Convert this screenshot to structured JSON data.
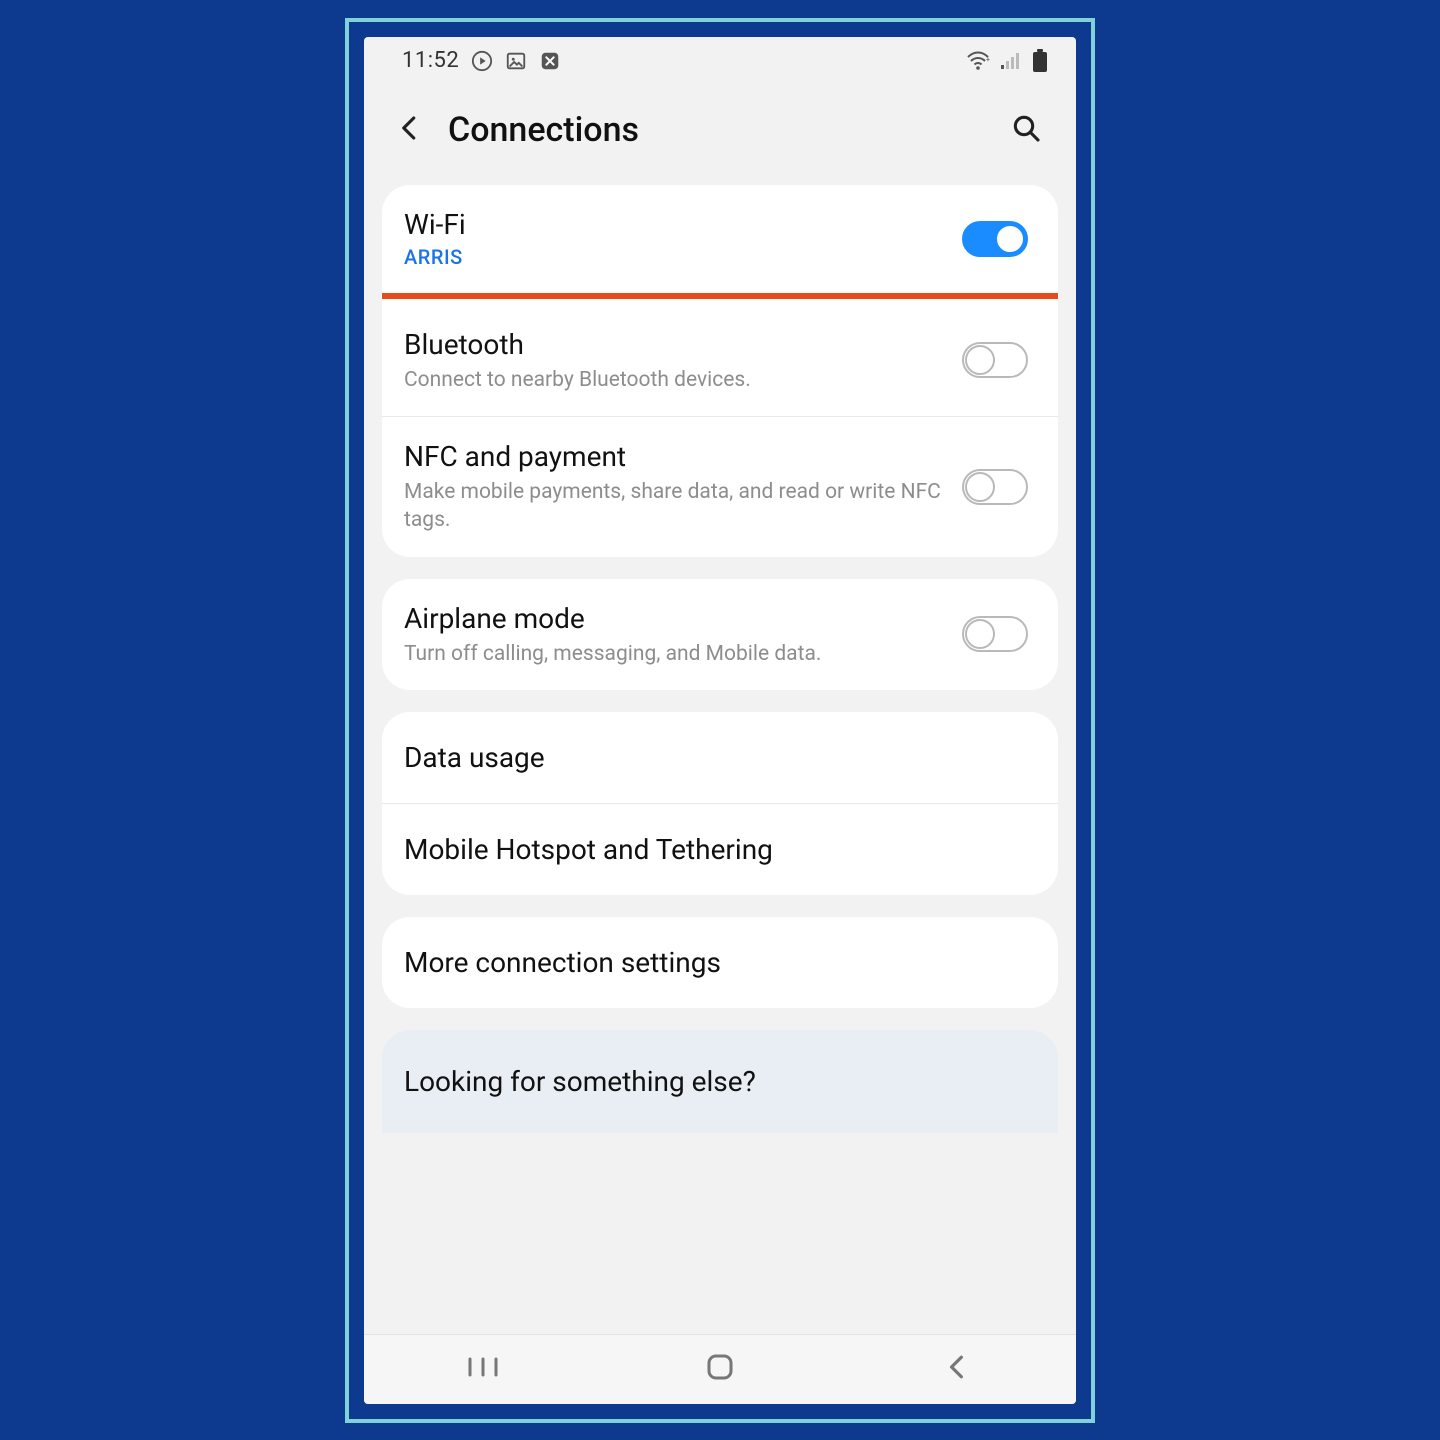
{
  "status": {
    "time": "11:52"
  },
  "header": {
    "title": "Connections"
  },
  "groups": [
    {
      "items": [
        {
          "title": "Wi-Fi",
          "subtitle": "ARRIS",
          "accent": true,
          "toggle": true,
          "on": true,
          "highlight": true
        },
        {
          "title": "Bluetooth",
          "subtitle": "Connect to nearby Bluetooth devices.",
          "toggle": true,
          "on": false
        },
        {
          "title": "NFC and payment",
          "subtitle": "Make mobile payments, share data, and read or write NFC tags.",
          "toggle": true,
          "on": false
        }
      ]
    },
    {
      "items": [
        {
          "title": "Airplane mode",
          "subtitle": "Turn off calling, messaging, and Mobile data.",
          "toggle": true,
          "on": false
        }
      ]
    },
    {
      "items": [
        {
          "title": "Data usage"
        },
        {
          "title": "Mobile Hotspot and Tethering"
        }
      ]
    },
    {
      "items": [
        {
          "title": "More connection settings"
        }
      ]
    },
    {
      "muted": true,
      "items": [
        {
          "title": "Looking for something else?",
          "looking": true
        }
      ]
    }
  ]
}
